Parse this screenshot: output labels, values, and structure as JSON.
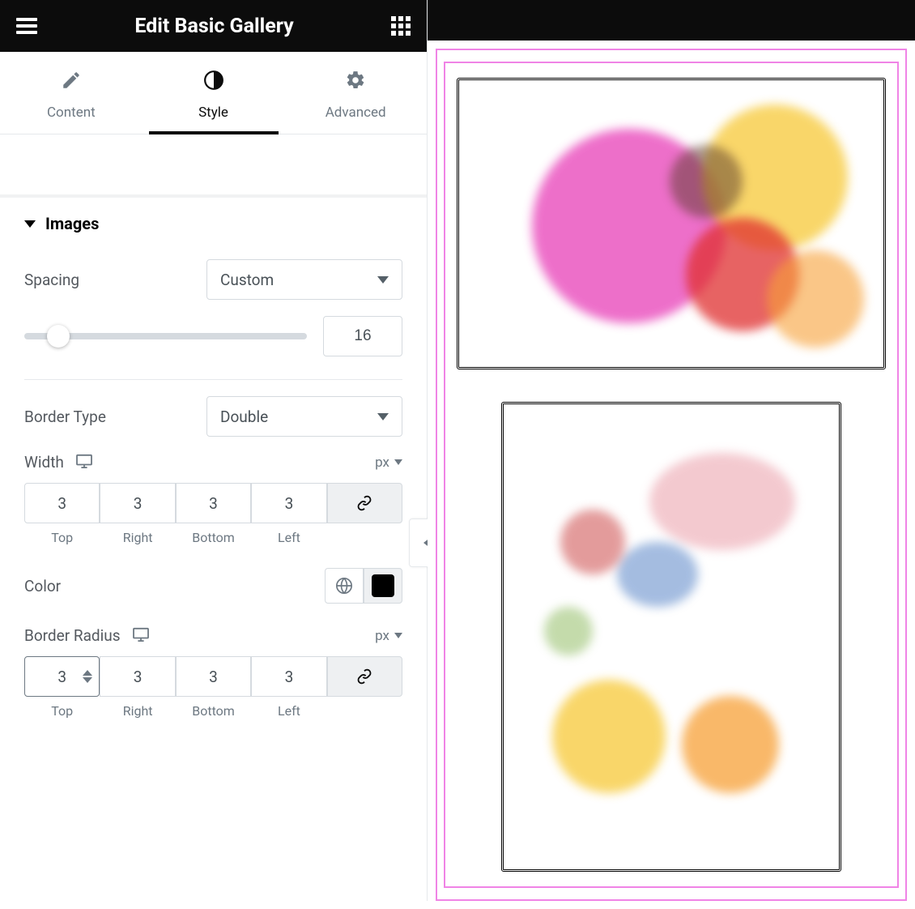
{
  "header": {
    "title": "Edit Basic Gallery"
  },
  "tabs": {
    "content": "Content",
    "style": "Style",
    "advanced": "Advanced",
    "active": "Style"
  },
  "section": {
    "title": "Images"
  },
  "spacing": {
    "label": "Spacing",
    "selected": "Custom",
    "value": "16"
  },
  "border_type": {
    "label": "Border Type",
    "selected": "Double"
  },
  "width": {
    "label": "Width",
    "unit": "px",
    "top": "3",
    "right": "3",
    "bottom": "3",
    "left": "3",
    "labels": {
      "top": "Top",
      "right": "Right",
      "bottom": "Bottom",
      "left": "Left"
    }
  },
  "color": {
    "label": "Color",
    "swatch": "#000000"
  },
  "border_radius": {
    "label": "Border Radius",
    "unit": "px",
    "top": "3",
    "right": "3",
    "bottom": "3",
    "left": "3",
    "labels": {
      "top": "Top",
      "right": "Right",
      "bottom": "Bottom",
      "left": "Left"
    }
  }
}
